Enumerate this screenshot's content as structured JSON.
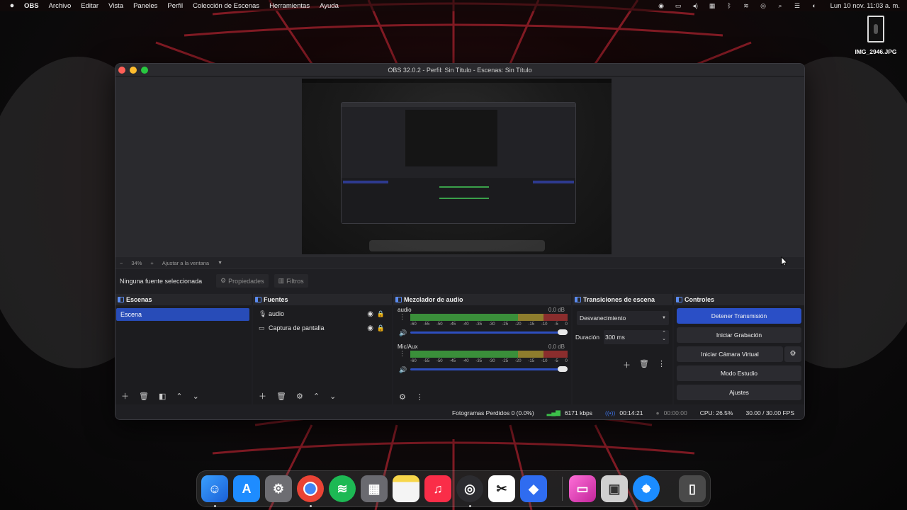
{
  "menubar": {
    "app": "OBS",
    "items": [
      "Archivo",
      "Editar",
      "Vista",
      "Paneles",
      "Perfil",
      "Colección de Escenas",
      "Herramientas",
      "Ayuda"
    ],
    "clock": "Lun 10 nov.  11:03 a. m."
  },
  "desktop": {
    "file_name": "IMG_2946.JPG"
  },
  "window": {
    "title": "OBS 32.0.2 - Perfil: Sin Título - Escenas: Sin Título"
  },
  "preview": {
    "zoom_minus": "−",
    "zoom_level": "34%",
    "zoom_plus": "+",
    "fit_label": "Ajustar a la ventana"
  },
  "properties_bar": {
    "no_source": "Ninguna fuente seleccionada",
    "properties_label": "Propiedades",
    "filters_label": "Filtros"
  },
  "scenes": {
    "title": "Escenas",
    "items": [
      "Escena"
    ]
  },
  "sources": {
    "title": "Fuentes",
    "items": [
      {
        "label": "audio",
        "icon": "microphone-icon"
      },
      {
        "label": "Captura de pantalla",
        "icon": "monitor-icon"
      }
    ]
  },
  "mixer": {
    "title": "Mezclador de audio",
    "ticks": [
      "-60",
      "-55",
      "-50",
      "-45",
      "-40",
      "-35",
      "-30",
      "-25",
      "-20",
      "-15",
      "-10",
      "-5",
      "0"
    ],
    "channels": [
      {
        "name": "audio",
        "db": "0.0 dB"
      },
      {
        "name": "Mic/Aux",
        "db": "0.0 dB"
      }
    ]
  },
  "transitions": {
    "title": "Transiciones de escena",
    "selected": "Desvanecimiento",
    "duration_label": "Duración",
    "duration_value": "300 ms"
  },
  "controls": {
    "title": "Controles",
    "stop_stream": "Detener Transmisión",
    "start_recording": "Iniciar Grabación",
    "start_virtual_cam": "Iniciar Cámara Virtual",
    "studio_mode": "Modo Estudio",
    "settings": "Ajustes"
  },
  "status": {
    "dropped_frames": "Fotogramas Perdidos 0 (0.0%)",
    "bitrate": "6171 kbps",
    "stream_time": "00:14:21",
    "record_time": "00:00:00",
    "cpu": "CPU: 26.5%",
    "fps": "30.00 / 30.00 FPS"
  },
  "colors": {
    "accent": "#2a4fc6",
    "scene_selected": "#284cb8",
    "meter_green": "#3a8f3a",
    "meter_yellow": "#8e7d2d",
    "meter_red": "#8a2d2d"
  },
  "dock_apps": [
    "Finder",
    "App Store",
    "Ajustes del Sistema",
    "Chrome",
    "Spotify",
    "Launchpad",
    "Notas",
    "Música",
    "OBS",
    "CapCut",
    "Roblox",
    "Fotos",
    "Vista Previa",
    "Safari",
    "Papelera"
  ]
}
